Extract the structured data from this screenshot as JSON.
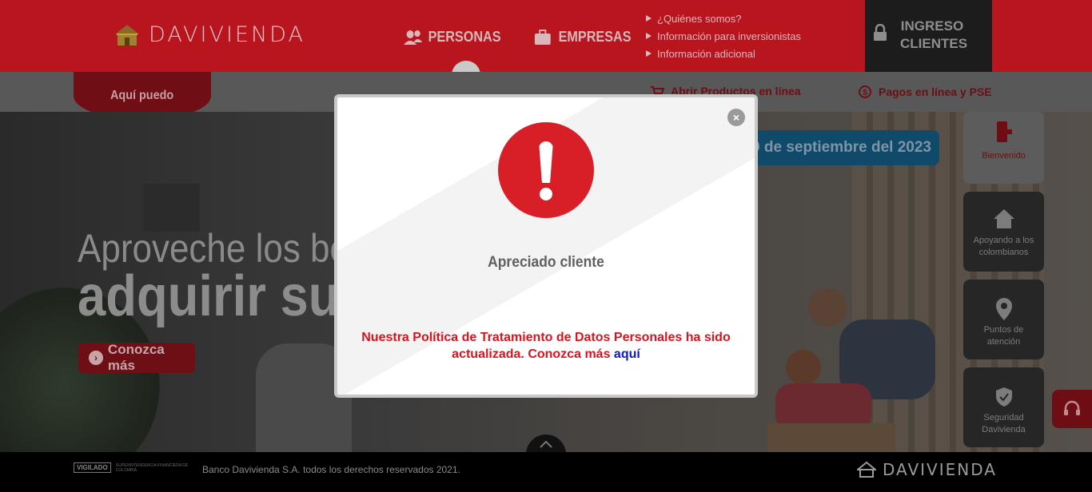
{
  "header": {
    "brand": "DAVIVIENDA",
    "nav_main": [
      {
        "label": "PERSONAS",
        "icon": "people-icon"
      },
      {
        "label": "EMPRESAS",
        "icon": "briefcase-icon"
      }
    ],
    "nav_links": [
      "¿Quiénes somos?",
      "Información para inversionistas",
      "Información adicional"
    ],
    "login": {
      "label": "INGRESO CLIENTES",
      "icon": "lock-icon"
    }
  },
  "subbar": {
    "aqui_puedo": "Aquí puedo",
    "link_products": "Abrir Productos en línea",
    "link_payments": "Pagos en línea y PSE"
  },
  "hero": {
    "headline_light": "Aproveche los be",
    "headline_bold": "adquirir su",
    "cta": "Conozca más",
    "date_banner": "0 de septiembre del 2023"
  },
  "side_widgets": [
    {
      "label": "Bienvenido",
      "icon": "exit-door-icon"
    },
    {
      "label": "Apoyando a los colombianos",
      "icon": "home-icon"
    },
    {
      "label": "Puntos de atención",
      "icon": "location-pin-icon"
    },
    {
      "label": "Seguridad Davivienda",
      "icon": "shield-check-icon"
    }
  ],
  "footer": {
    "vigilado": "VIGILADO",
    "superintendencia": "SUPERINTENDENCIA FINANCIERA DE COLOMBIA",
    "copyright": "Banco Davivienda S.A. todos los derechos reservados 2021.",
    "brand": "DAVIVIENDA"
  },
  "modal": {
    "title": "Apreciado cliente",
    "message": "Nuestra Política de Tratamiento de Datos Personales ha sido actualizada. Conozca más",
    "link": "aquí",
    "close": "×"
  },
  "colors": {
    "brand_red": "#d81f27",
    "link_blue": "#1018c0"
  }
}
